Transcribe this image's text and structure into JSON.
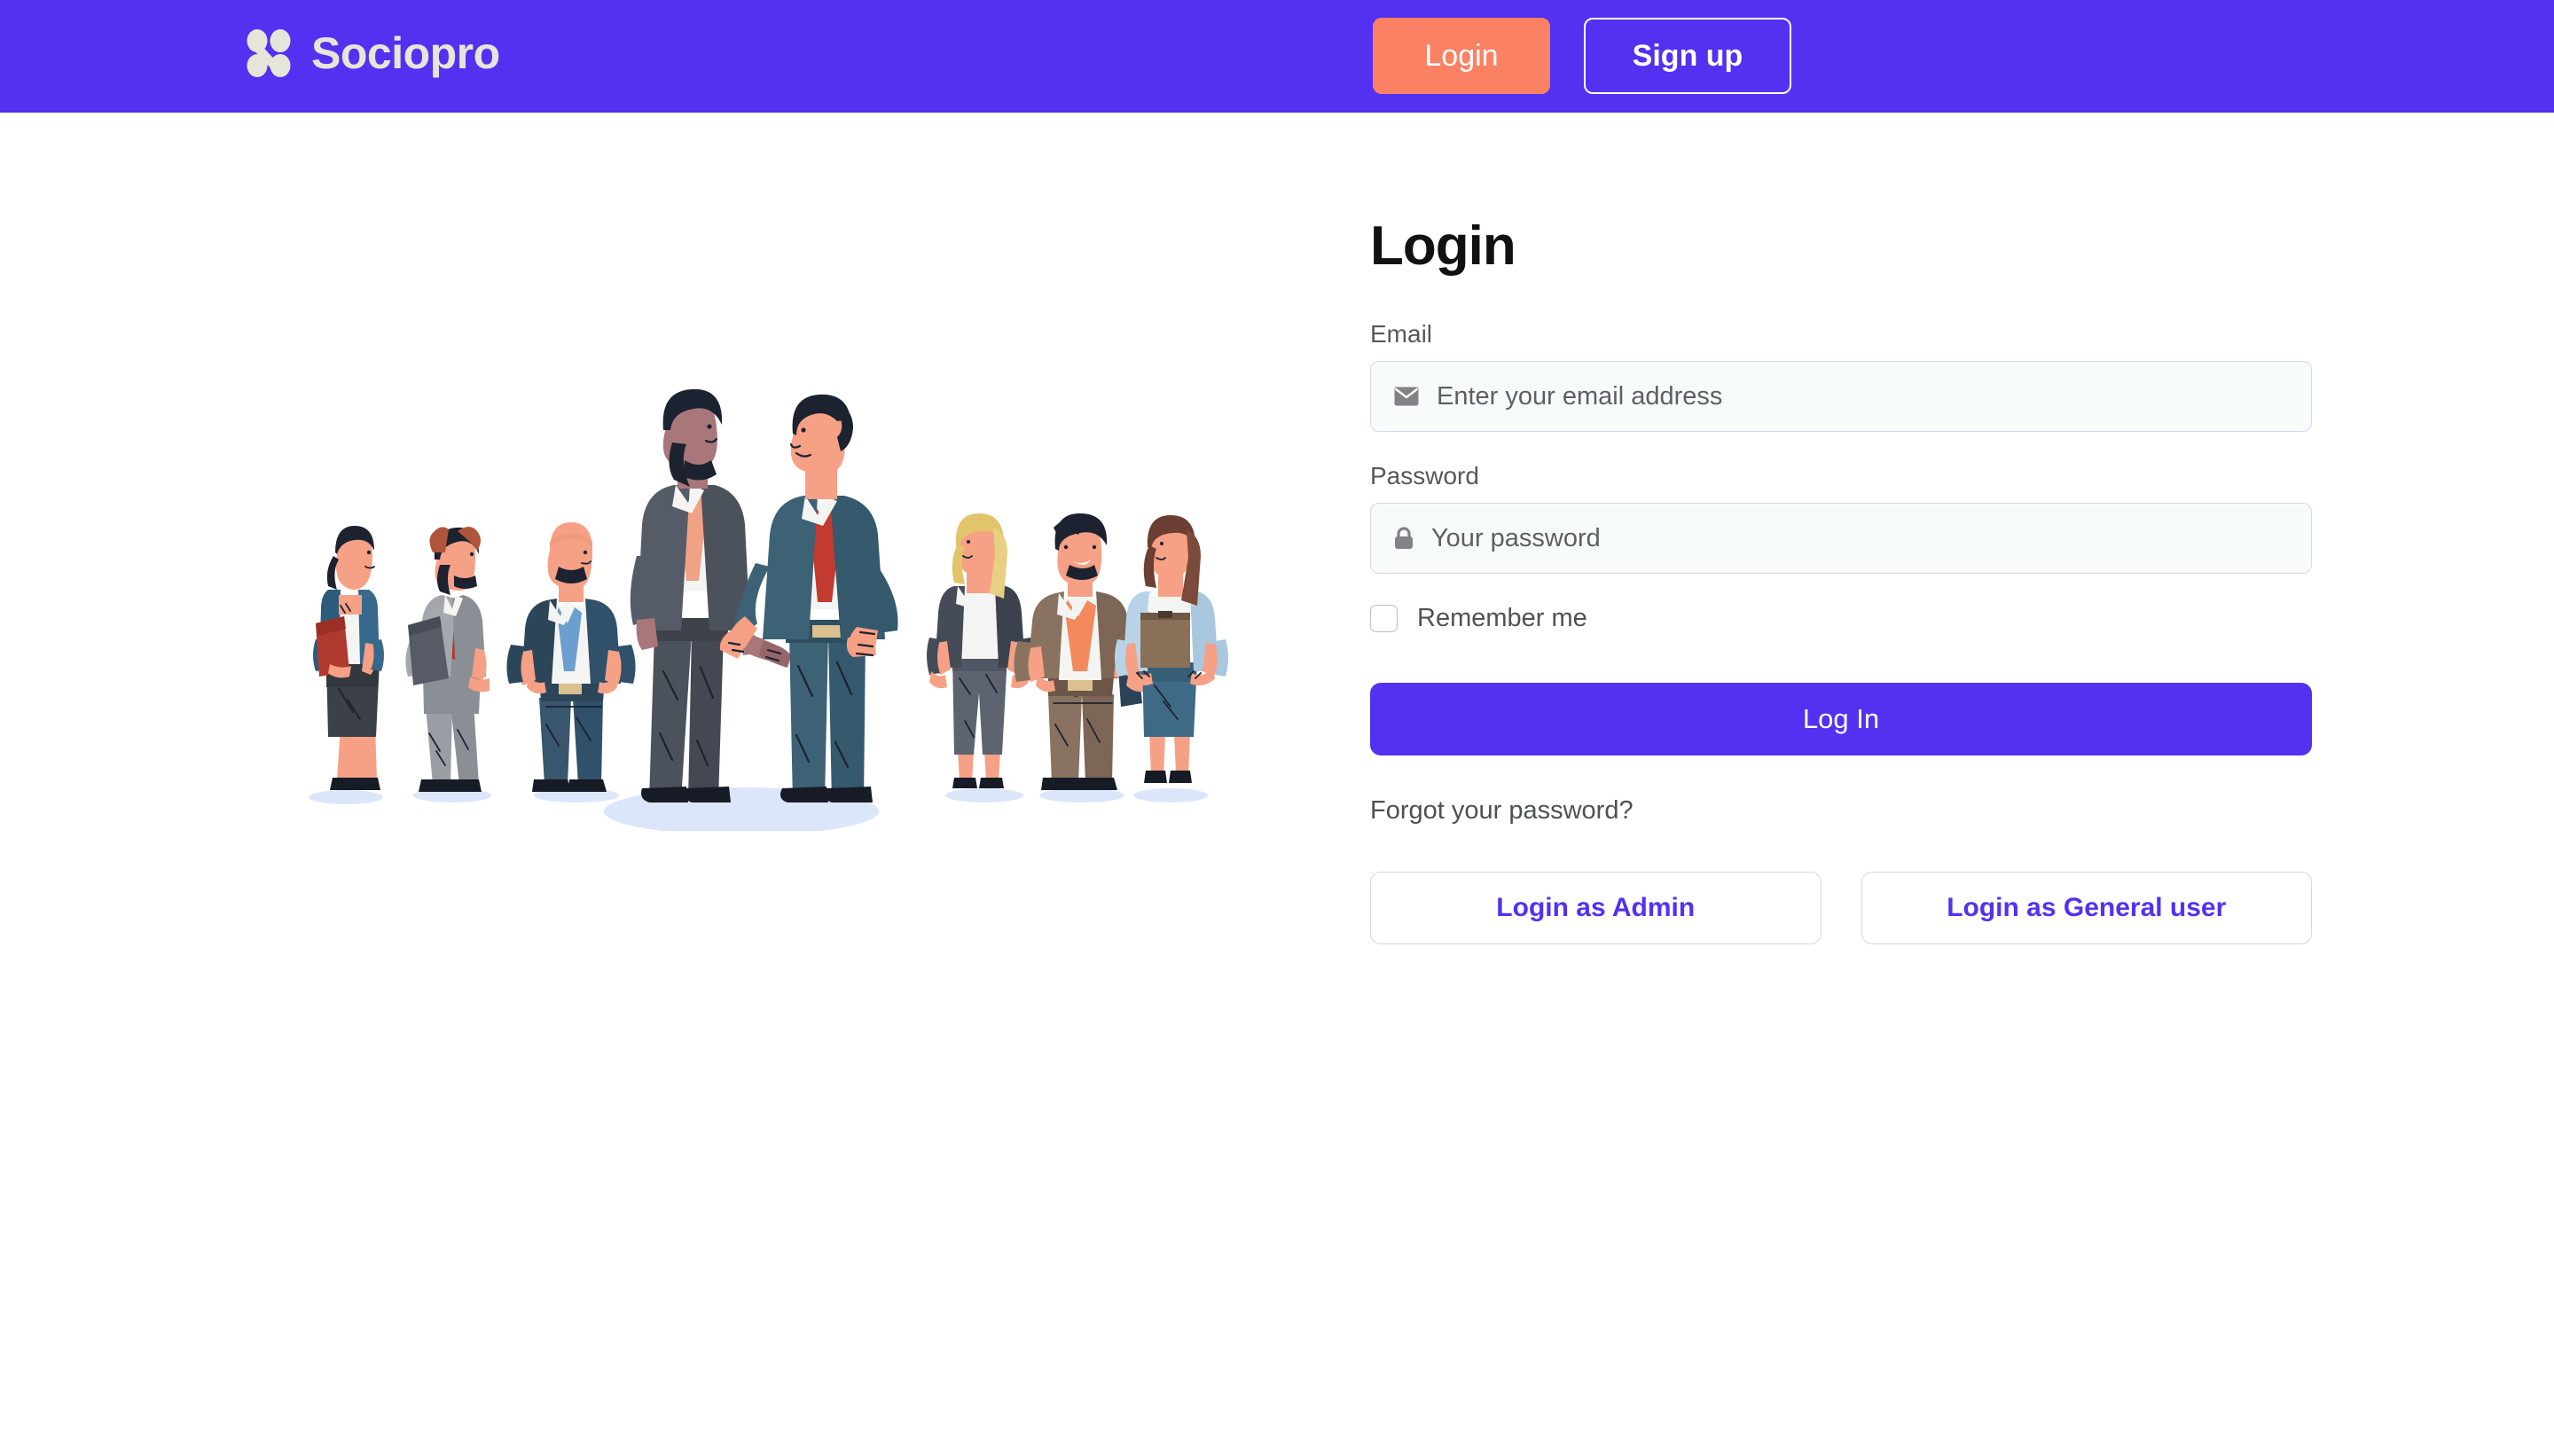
{
  "header": {
    "brand_name": "Sociopro",
    "brand_icon": "four-dot-cluster-logo-icon",
    "login_button": "Login",
    "signup_button": "Sign up",
    "background_color": "#5430f0",
    "login_button_color": "#fa8163"
  },
  "illustration": {
    "name": "business-people-handshake-illustration",
    "alt": "Group of eight business people, two central figures shaking hands",
    "figure_count": 8,
    "shadow_color": "#dbe6fb"
  },
  "form": {
    "title": "Login",
    "email": {
      "label": "Email",
      "placeholder": "Enter your email address",
      "value": "",
      "icon": "envelope-icon"
    },
    "password": {
      "label": "Password",
      "placeholder": "Your password",
      "value": "",
      "icon": "lock-icon"
    },
    "remember_me": {
      "label": "Remember me",
      "checked": false
    },
    "submit_button": "Log In",
    "forgot_password_link": "Forgot your password?",
    "alt_logins": [
      {
        "label": "Login as Admin"
      },
      {
        "label": "Login as General user"
      }
    ],
    "accent_color": "#5430f0",
    "input_background": "#f7fcfa",
    "input_border": "#d9d5f2"
  }
}
